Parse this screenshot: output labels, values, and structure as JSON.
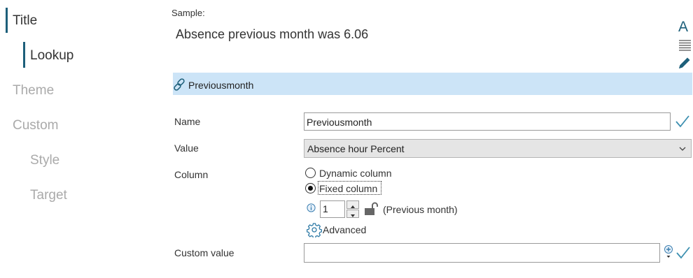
{
  "nav": {
    "items": [
      {
        "label": "Title"
      },
      {
        "label": "Lookup"
      },
      {
        "label": "Theme"
      },
      {
        "label": "Custom"
      },
      {
        "label": "Style"
      },
      {
        "label": "Target"
      }
    ]
  },
  "sample": {
    "label": "Sample:",
    "text": "Absence previous month was 6.06"
  },
  "toolbar": {
    "font_icon_text": "A"
  },
  "header": {
    "title": "Previousmonth"
  },
  "form": {
    "name": {
      "label": "Name",
      "value": "Previousmonth"
    },
    "value": {
      "label": "Value",
      "selected": "Absence hour Percent"
    },
    "column": {
      "label": "Column",
      "options": [
        {
          "label": "Dynamic column",
          "checked": false
        },
        {
          "label": "Fixed column",
          "checked": true
        }
      ],
      "offset": "1",
      "offset_hint": "(Previous month)",
      "advanced_label": "Advanced"
    },
    "custom_value": {
      "label": "Custom value",
      "value": ""
    }
  },
  "colors": {
    "accent": "#1d5f7a",
    "header_bg": "#cce4f7",
    "nav_inactive": "#aaaaaa"
  }
}
